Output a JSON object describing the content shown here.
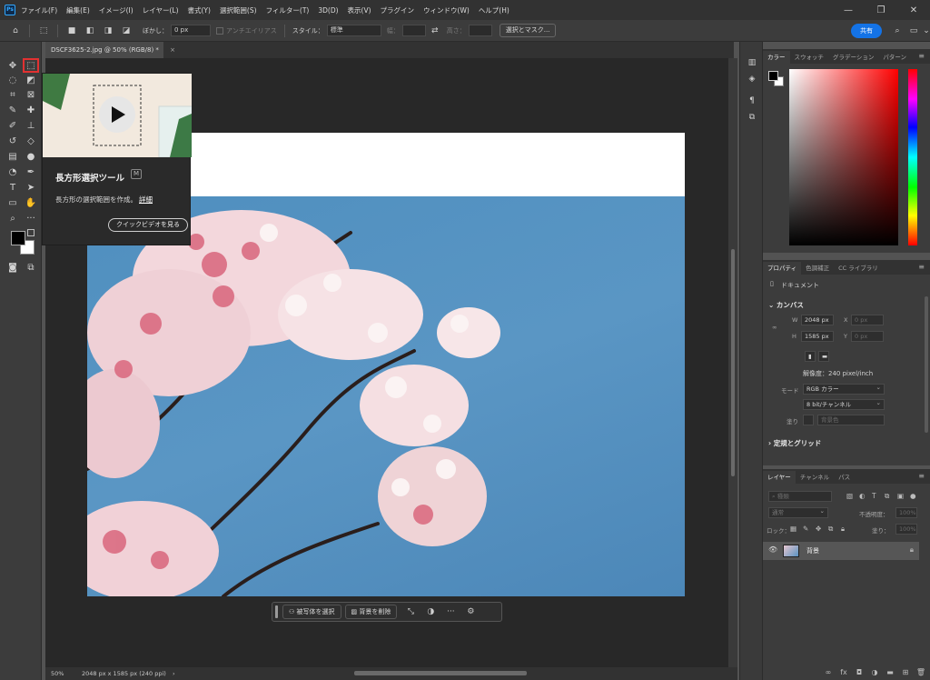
{
  "menubar": {
    "logo": "Ps",
    "items": [
      "ファイル(F)",
      "編集(E)",
      "イメージ(I)",
      "レイヤー(L)",
      "書式(Y)",
      "選択範囲(S)",
      "フィルター(T)",
      "3D(D)",
      "表示(V)",
      "プラグイン",
      "ウィンドウ(W)",
      "ヘルプ(H)"
    ],
    "window_controls": [
      "—",
      "❐",
      "✕"
    ]
  },
  "options": {
    "feather_label": "ぼかし：",
    "feather_value": "0 px",
    "antialias_label": "アンチエイリアス",
    "style_label": "スタイル：",
    "style_value": "標準",
    "width_label": "幅：",
    "height_label": "高さ：",
    "select_mask_button": "選択とマスク...",
    "share_button": "共有"
  },
  "document": {
    "tab_title": "DSCF3625-2.jpg @ 50% (RGB/8) *",
    "tab_close": "×"
  },
  "tooltip": {
    "title": "長方形選択ツール",
    "shortcut": "M",
    "description": "長方形の選択範囲を作成。",
    "detail_link": "詳細",
    "video_button": "クイックビデオを見る"
  },
  "contextual_bar": {
    "select_subject": "被写体を選択",
    "remove_background": "背景を削除",
    "more": "···"
  },
  "status": {
    "zoom": "50%",
    "doc_info": "2048 px x 1585 px (240 ppi)",
    "arrow": "›"
  },
  "color_panel": {
    "tabs": [
      "カラー",
      "スウォッチ",
      "グラデーション",
      "パターン"
    ],
    "foreground": "#000000",
    "background": "#ffffff"
  },
  "properties_panel": {
    "tabs": [
      "プロパティ",
      "色調補正",
      "CC ライブラリ"
    ],
    "document_label": "ドキュメント",
    "canvas_heading": "カンバス",
    "w_label": "W",
    "w_value": "2048 px",
    "h_label": "H",
    "h_value": "1585 px",
    "x_label": "X",
    "x_value": "0 px",
    "y_label": "Y",
    "y_value": "0 px",
    "resolution": "解像度：240 pixel/inch",
    "mode_label": "モード",
    "mode_value": "RGB カラー",
    "bit_value": "8 bit/チャンネル",
    "fill_label": "塗り",
    "fill_value": "背景色",
    "rulers_heading": "定規とグリッド"
  },
  "layers_panel": {
    "tabs": [
      "レイヤー",
      "チャンネル",
      "パス"
    ],
    "search_placeholder": "種類",
    "blend_mode": "通常",
    "opacity_label": "不透明度：",
    "opacity_value": "100%",
    "lock_label": "ロック：",
    "fill_label": "塗り：",
    "fill_value": "100%",
    "layer_name": "背景"
  }
}
